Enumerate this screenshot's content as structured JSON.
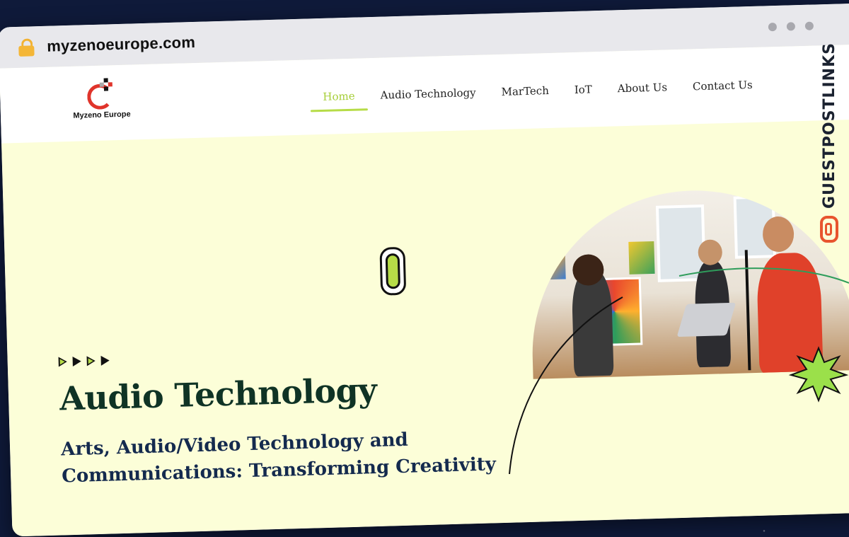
{
  "browser": {
    "url": "myzenoeurope.com"
  },
  "site": {
    "logo_text": "Myzeno Europe",
    "nav": [
      {
        "label": "Home",
        "active": true
      },
      {
        "label": "Audio Technology",
        "active": false
      },
      {
        "label": "MarTech",
        "active": false
      },
      {
        "label": "IoT",
        "active": false
      },
      {
        "label": "About Us",
        "active": false
      },
      {
        "label": "Contact Us",
        "active": false
      }
    ]
  },
  "hero": {
    "title": "Audio Technology",
    "subtitle": "Arts, Audio/Video Technology and Communications: Transforming Creativity"
  },
  "watermark": {
    "text": "GUESTPOSTLINKS"
  },
  "colors": {
    "accent": "#b6dc47",
    "hero_bg": "#fcfed8",
    "title": "#0f3325",
    "subtitle": "#142a4e",
    "logo_red": "#e0342b",
    "watermark_orange": "#e8542e"
  },
  "icons": [
    "lock-icon",
    "paperclip-icon",
    "play-arrow-icon",
    "starburst-icon",
    "link-icon"
  ]
}
